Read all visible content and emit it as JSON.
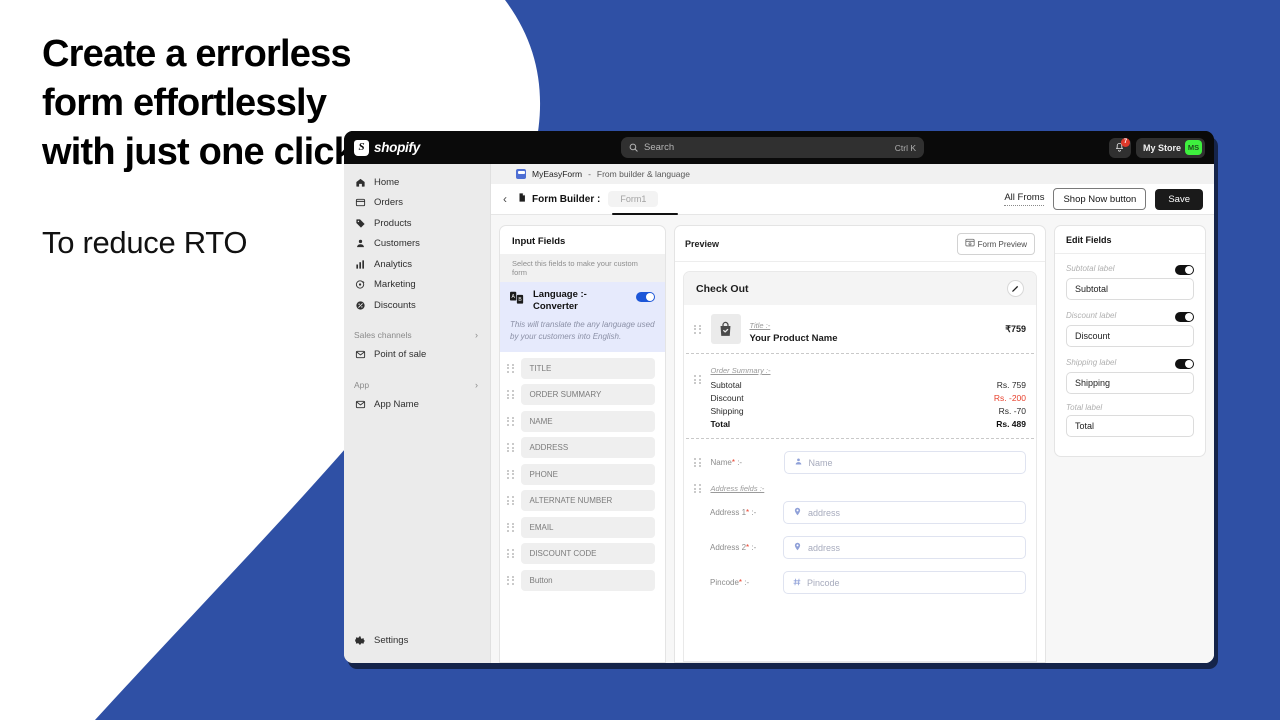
{
  "theme": {
    "brand_blue": "#2F50A5",
    "accent_red": "#E8402C",
    "green": "#3EF03E",
    "dark": "#0A0A0A"
  },
  "promo": {
    "headline": "Create a errorless form effortlessly with just one click.",
    "subline": "To reduce RTO"
  },
  "topbar": {
    "logo_text": "shopify",
    "search_placeholder": "Search",
    "search_value": "",
    "search_shortcut": "Ctrl K",
    "notification_count": "7",
    "store_name": "My Store",
    "store_initials": "MS"
  },
  "sidebar": {
    "items": [
      {
        "label": "Home",
        "icon": "home-icon"
      },
      {
        "label": "Orders",
        "icon": "orders-icon"
      },
      {
        "label": "Products",
        "icon": "products-tag-icon"
      },
      {
        "label": "Customers",
        "icon": "customers-person-icon"
      },
      {
        "label": "Analytics",
        "icon": "analytics-bars-icon"
      },
      {
        "label": "Marketing",
        "icon": "marketing-megaphone-icon"
      },
      {
        "label": "Discounts",
        "icon": "discounts-icon"
      }
    ],
    "groups": [
      {
        "label": "Sales channels",
        "items": [
          {
            "label": "Point of sale",
            "icon": "pos-envelope-icon"
          }
        ]
      },
      {
        "label": "App",
        "items": [
          {
            "label": "App Name",
            "icon": "app-envelope-icon"
          }
        ]
      }
    ],
    "settings": {
      "label": "Settings",
      "icon": "gear-icon"
    }
  },
  "breadcrumb": {
    "app_name": "MyEasyForm",
    "separator": "-",
    "page": "From builder & language"
  },
  "form_builder": {
    "title": "Form Builder :",
    "form_pill": "Form1",
    "all_forms": "All Froms",
    "shop_now_button": "Shop Now button",
    "save_button": "Save"
  },
  "input_fields": {
    "title": "Input Fields",
    "subtitle": "Select this fields to make your custom form",
    "language_converter": {
      "label": "Language  :- Converter",
      "description": "This will translate the any language used by your customers into English.",
      "enabled": true
    },
    "fields": [
      {
        "label": "TITLE"
      },
      {
        "label": "ORDER SUMMARY"
      },
      {
        "label": "NAME"
      },
      {
        "label": "ADDRESS"
      },
      {
        "label": "PHONE"
      },
      {
        "label": "ALTERNATE NUMBER"
      },
      {
        "label": "EMAIL"
      },
      {
        "label": "DISCOUNT CODE"
      },
      {
        "label": "Button"
      }
    ]
  },
  "preview": {
    "title": "Preview",
    "form_preview_button": "Form Preview",
    "checkout_title": "Check Out",
    "product": {
      "mini_label": "Title :-",
      "name": "Your Product Name",
      "price": "₹759"
    },
    "order_summary": {
      "mini_label": "Order Summary :-",
      "rows": [
        {
          "label": "Subtotal",
          "value": "Rs. 759",
          "negative": false
        },
        {
          "label": "Discount",
          "value": "Rs. -200",
          "negative": true
        },
        {
          "label": "Shipping",
          "value": "Rs. -70",
          "negative": false
        }
      ],
      "total": {
        "label": "Total",
        "value": "Rs.  489"
      }
    },
    "name_field": {
      "label": "Name",
      "required": "*",
      "suffix": ":-",
      "placeholder": "Name"
    },
    "address_section_label": "Address fields :-",
    "address_fields": [
      {
        "label": "Address 1",
        "required": "*",
        "suffix": ":-",
        "placeholder": "address"
      },
      {
        "label": "Address 2",
        "required": "*",
        "suffix": ":-",
        "placeholder": "address"
      },
      {
        "label": "Pincode",
        "required": "*",
        "suffix": ":-",
        "placeholder": "Pincode"
      }
    ]
  },
  "edit_fields": {
    "title": "Edit Fields",
    "groups": [
      {
        "label": "Subtotal label",
        "value": "Subtotal",
        "toggle": true
      },
      {
        "label": "Discount label",
        "value": "Discount",
        "toggle": true
      },
      {
        "label": "Shipping label",
        "value": "Shipping",
        "toggle": true
      },
      {
        "label": "Total label",
        "value": "Total",
        "toggle": false
      }
    ]
  }
}
